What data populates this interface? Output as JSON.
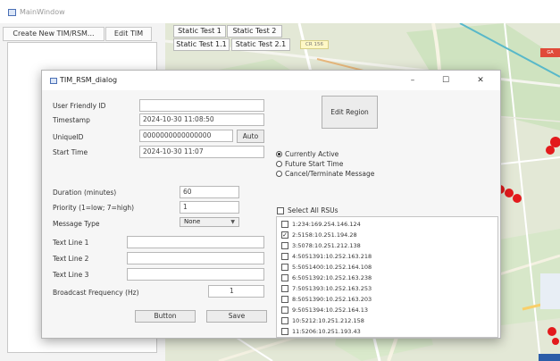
{
  "main_window": {
    "title": "MainWindow",
    "create_button": "Create New TIM/RSM...",
    "edit_button": "Edit TIM"
  },
  "map": {
    "tabs": [
      "Static Test 1",
      "Static Test 2",
      "Static Test 1.1",
      "Static Test 2.1"
    ],
    "road_badge": "CR 156",
    "corner_label": "GA"
  },
  "dialog": {
    "title": "TIM_RSM_dialog",
    "controls": {
      "minimize": "–",
      "maximize": "☐",
      "close": "✕"
    },
    "fields": {
      "user_friendly_id_label": "User Friendly ID",
      "user_friendly_id_value": "",
      "timestamp_label": "Timestamp",
      "timestamp_value": "2024-10-30 11:08:50",
      "unique_id_label": "UniqueID",
      "unique_id_value": "0000000000000000",
      "auto_button": "Auto",
      "start_time_label": "Start Time",
      "start_time_value": "2024-10-30 11:07",
      "duration_label": "Duration (minutes)",
      "duration_value": "60",
      "priority_label": "Priority (1=low; 7=high)",
      "priority_value": "1",
      "message_type_label": "Message Type",
      "message_type_value": "None",
      "text_line_1_label": "Text Line 1",
      "text_line_2_label": "Text Line 2",
      "text_line_3_label": "Text Line 3",
      "broadcast_label": "Broadcast Frequency (Hz)",
      "broadcast_value": "1"
    },
    "edit_region_button": "Edit Region",
    "status_options": [
      {
        "label": "Currently Active",
        "checked": true
      },
      {
        "label": "Future Start Time",
        "checked": false
      },
      {
        "label": "Cancel/Terminate Message",
        "checked": false
      }
    ],
    "select_all_label": "Select All RSUs",
    "rsus": [
      {
        "label": "1:234:169.254.146.124",
        "checked": false
      },
      {
        "label": "2:5158:10.251.194.28",
        "checked": true
      },
      {
        "label": "3:5078:10.251.212.138",
        "checked": false
      },
      {
        "label": "4:5051391:10.252.163.218",
        "checked": false
      },
      {
        "label": "5:5051400:10.252.164.108",
        "checked": false
      },
      {
        "label": "6:5051392:10.252.163.238",
        "checked": false
      },
      {
        "label": "7:5051393:10.252.163.253",
        "checked": false
      },
      {
        "label": "8:5051390:10.252.163.203",
        "checked": false
      },
      {
        "label": "9:5051394:10.252.164.13",
        "checked": false
      },
      {
        "label": "10:5212:10.251.212.158",
        "checked": false
      },
      {
        "label": "11:5206:10.251.193.43",
        "checked": false
      }
    ],
    "button_label": "Button",
    "save_label": "Save"
  }
}
